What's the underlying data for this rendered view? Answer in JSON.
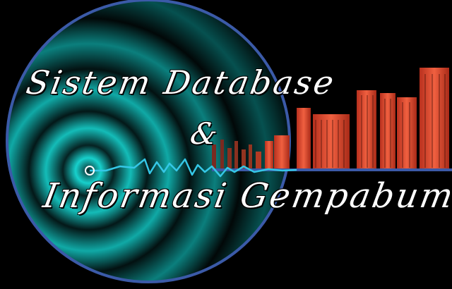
{
  "title": {
    "line1": "Sistem Database",
    "ampersand": "&",
    "line2": "Informasi Gempabumi"
  },
  "colors": {
    "background": "#000000",
    "ring": "#3b5aa8",
    "teal": "#0fb5b5",
    "building": "#e0452a",
    "seismograph": "#35c7e6"
  },
  "icons": [
    "seismic-wave-rings",
    "city-skyline",
    "seismograph-line"
  ]
}
